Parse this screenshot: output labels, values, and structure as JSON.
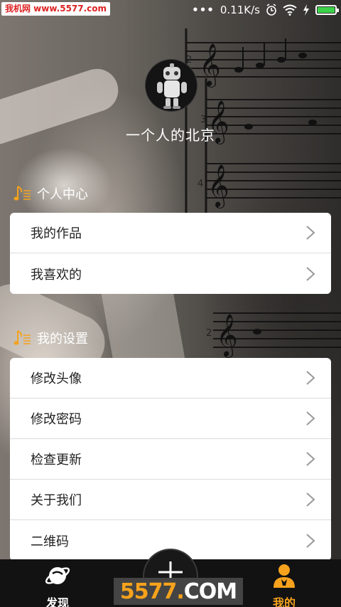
{
  "statusbar": {
    "watermark": "我机网 www.5577.com",
    "dots": "•••",
    "network_speed": "0.11K/s",
    "battery_color": "#3cd24a"
  },
  "profile": {
    "username": "一个人的北京"
  },
  "sections": [
    {
      "title": "个人中心",
      "items": [
        "我的作品",
        "我喜欢的"
      ]
    },
    {
      "title": "我的设置",
      "items": [
        "修改头像",
        "修改密码",
        "检查更新",
        "关于我们",
        "二维码"
      ]
    }
  ],
  "nav": {
    "discover_label": "发现",
    "mine_label": "我的",
    "active_color": "#f6a21c",
    "inactive_color": "#ffffff"
  },
  "watermark_bottom": {
    "num": "5577",
    "dot": ".",
    "com": "COM"
  },
  "colors": {
    "accent": "#f6a21c",
    "card_bg": "#ffffff",
    "nav_bg": "#121212"
  }
}
